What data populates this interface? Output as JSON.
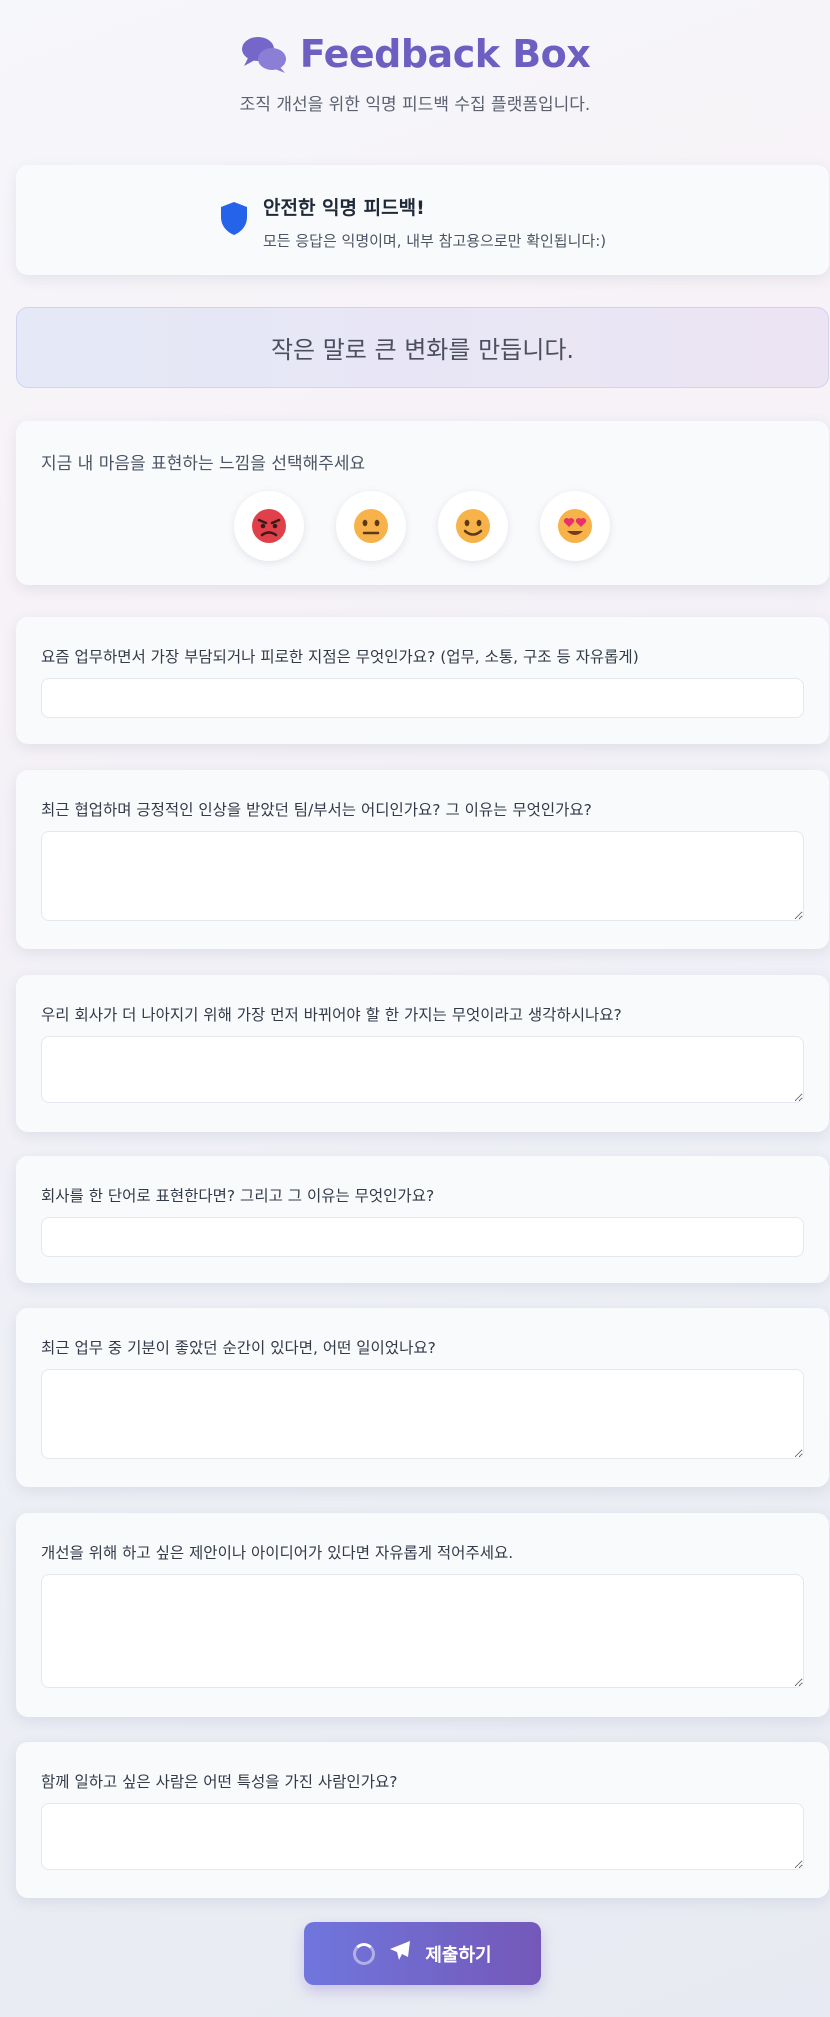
{
  "header": {
    "title": "Feedback Box",
    "subtitle": "조직 개선을 위한 익명 피드백 수집 플랫폼입니다.",
    "icon": "comments-icon"
  },
  "secure_notice": {
    "title": "안전한 익명 피드백!",
    "subtitle": "모든 응답은 익명이며, 내부 참고용으로만 확인됩니다:)",
    "icon": "shield-icon"
  },
  "motto": "작은 말로 큰 변화를 만듭니다.",
  "mood": {
    "label": "지금 내 마음을 표현하는 느낌을 선택해주세요",
    "options": [
      "angry-face",
      "neutral-face",
      "smiling-face",
      "heart-eyes-face"
    ]
  },
  "questions": [
    {
      "label": "요즘 업무하면서 가장 부담되거나 피로한 지점은 무엇인가요? (업무, 소통, 구조 등 자유롭게)",
      "value": ""
    },
    {
      "label": "최근 협업하며 긍정적인 인상을 받았던 팀/부서는 어디인가요? 그 이유는 무엇인가요?",
      "value": ""
    },
    {
      "label": "우리 회사가 더 나아지기 위해 가장 먼저 바뀌어야 할 한 가지는 무엇이라고 생각하시나요?",
      "value": ""
    },
    {
      "label": "회사를 한 단어로 표현한다면? 그리고 그 이유는 무엇인가요?",
      "value": ""
    },
    {
      "label": "최근 업무 중 기분이 좋았던 순간이 있다면, 어떤 일이었나요?",
      "value": ""
    },
    {
      "label": "개선을 위해 하고 싶은 제안이나 아이디어가 있다면 자유롭게 적어주세요.",
      "value": ""
    },
    {
      "label": "함께 일하고 싶은 사람은 어떤 특성을 가진 사람인가요?",
      "value": ""
    }
  ],
  "submit_label": "제출하기",
  "colors": {
    "brand": "#6d5fc2",
    "shield": "#2563eb",
    "button_start": "#7076dd",
    "button_end": "#7458b8"
  }
}
